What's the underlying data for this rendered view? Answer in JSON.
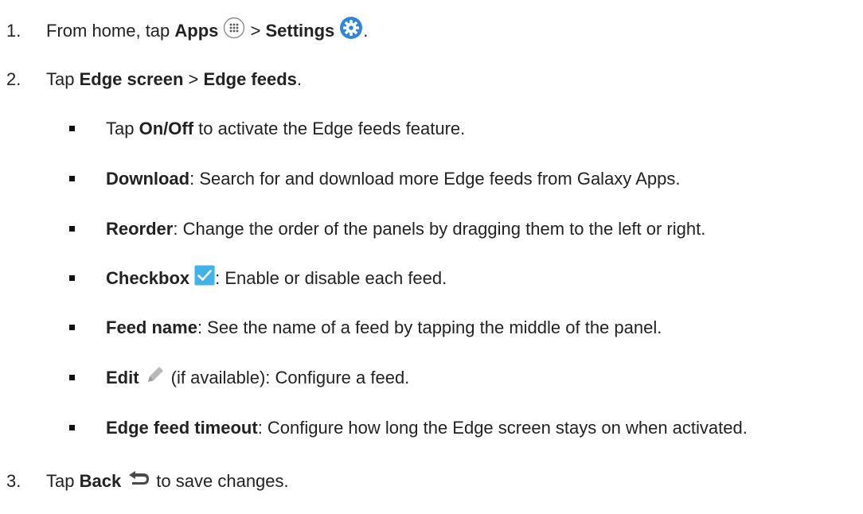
{
  "steps": [
    {
      "num": "1.",
      "a": "From home, tap ",
      "b1": "Apps",
      "sep": " > ",
      "b2": "Settings",
      "end": ".",
      "icons": [
        "apps-grid-icon",
        "settings-gear-icon"
      ]
    },
    {
      "num": "2.",
      "a": "Tap ",
      "b1": "Edge screen",
      "sep": " > ",
      "b2": "Edge feeds",
      "end": "."
    },
    {
      "num": "3.",
      "a": "Tap ",
      "b1": "Back",
      "end": " to save changes.",
      "icons": [
        "back-arrow-icon"
      ]
    }
  ],
  "bullets": [
    {
      "pre": "Tap ",
      "bold": "On/Off",
      "rest": " to activate the Edge feeds feature."
    },
    {
      "bold": "Download",
      "rest": ": Search for and download more Edge feeds from Galaxy Apps."
    },
    {
      "bold": "Reorder",
      "rest": ": Change the order of the panels by dragging them to the left or right."
    },
    {
      "bold": "Checkbox",
      "rest": ": Enable or disable each feed.",
      "icon": "checkbox-checked-icon"
    },
    {
      "bold": "Feed name",
      "rest": ": See the name of a feed by tapping the middle of the panel."
    },
    {
      "bold": "Edit",
      "rest": " (if available): Configure a feed.",
      "icon": "pencil-edit-icon"
    },
    {
      "bold": "Edge feed timeout",
      "rest": ": Configure how long the Edge screen stays on when activated."
    }
  ],
  "colors": {
    "text": "#222222",
    "settings_icon": "#2e86de",
    "checkbox_icon": "#42b3e8",
    "pencil_icon": "#b8b8b8"
  }
}
